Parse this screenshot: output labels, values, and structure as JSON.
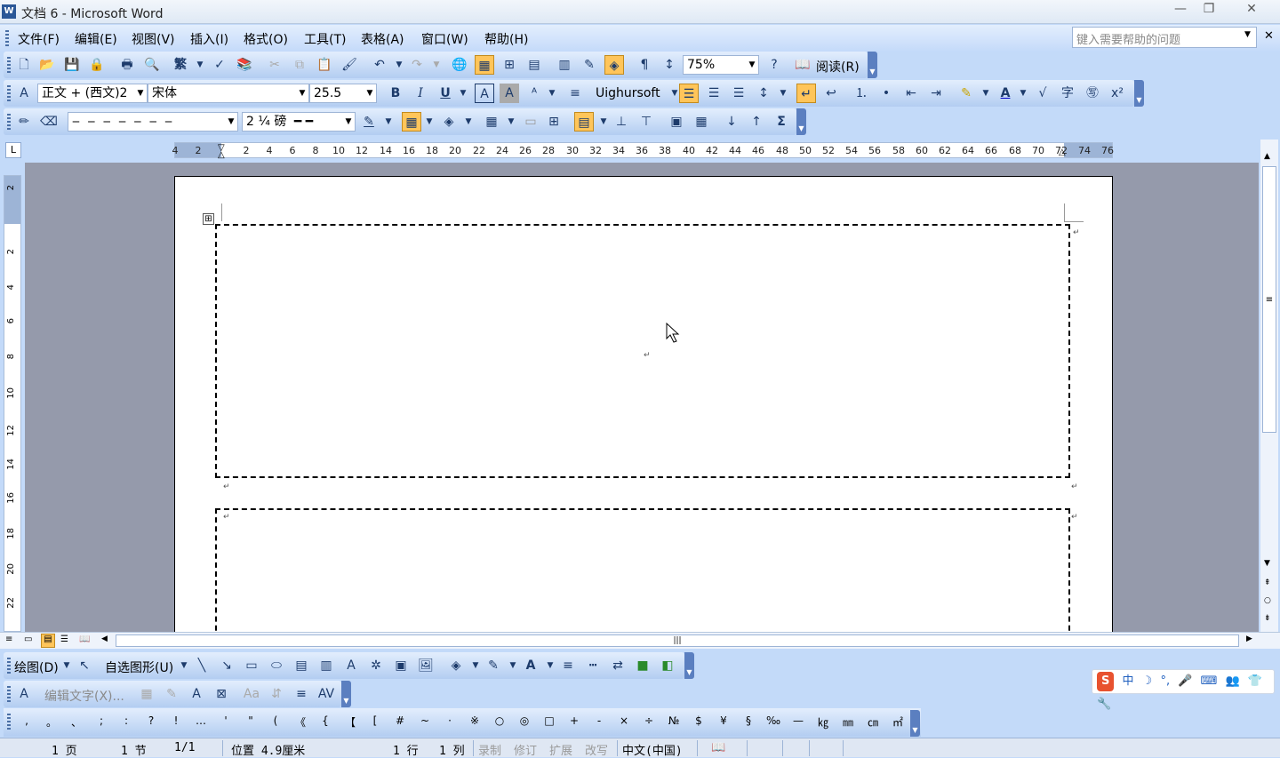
{
  "window": {
    "title": "文档 6 - Microsoft Word",
    "app_icon": "W",
    "controls": {
      "minimize": "—",
      "restore": "❐",
      "close": "✕"
    }
  },
  "menu": {
    "items": [
      "文件(F)",
      "编辑(E)",
      "视图(V)",
      "插入(I)",
      "格式(O)",
      "工具(T)",
      "表格(A)",
      "窗口(W)",
      "帮助(H)"
    ],
    "help_placeholder": "键入需要帮助的问题",
    "close_glyph": "✕"
  },
  "standard_toolbar": {
    "zoom": "75%",
    "read_label": "阅读(R)",
    "traditional_label": "繁"
  },
  "format_toolbar": {
    "style": "正文 + (西文)2",
    "font": "宋体",
    "size": "25.5",
    "uighur": "Uighursoft"
  },
  "tables_toolbar": {
    "line_weight": "2 ¼ 磅"
  },
  "ruler": {
    "numbers": [
      "4",
      "2",
      "2",
      "4",
      "6",
      "8",
      "10",
      "12",
      "14",
      "16",
      "18",
      "20",
      "22",
      "24",
      "26",
      "28",
      "30",
      "32",
      "34",
      "36",
      "38",
      "40",
      "42",
      "44",
      "46",
      "48",
      "50",
      "52",
      "54",
      "56",
      "58",
      "60",
      "62",
      "64",
      "66",
      "68",
      "70",
      "72",
      "74",
      "76"
    ],
    "vertical_numbers": [
      "2",
      "2",
      "4",
      "6",
      "8",
      "10",
      "12",
      "14",
      "16",
      "18",
      "20",
      "22"
    ],
    "tab_glyph": "L"
  },
  "document": {
    "paragraph_mark": "↵",
    "move_handle": "⊞"
  },
  "drawing_toolbar": {
    "draw_label": "绘图(D)",
    "autoshape_label": "自选图形(U)"
  },
  "wordart_toolbar": {
    "edit_text_label": "编辑文字(X)..."
  },
  "symbols": [
    ",",
    "。",
    "、",
    ";",
    ":",
    "?",
    "!",
    "…",
    "'",
    "\"",
    "(",
    "《",
    "{",
    "【",
    "[",
    "#",
    "~",
    "·",
    "※",
    "○",
    "◎",
    "□",
    "+",
    "-",
    "×",
    "÷",
    "№",
    "$",
    "¥",
    "§",
    "‰",
    "—",
    "㎏",
    "㎜",
    "㎝",
    "㎡"
  ],
  "ime": {
    "logo": "S",
    "items": [
      "中",
      "☽",
      "°,",
      "🎤",
      "⌨",
      "👥",
      "👕",
      "🔧"
    ]
  },
  "status_bar": {
    "page": "1 页",
    "section": "1 节",
    "pages": "1/1",
    "position": "位置 4.9厘米",
    "line": "1 行",
    "column": "1 列",
    "rec": "录制",
    "trk": "修订",
    "ext": "扩展",
    "ovr": "改写",
    "language": "中文(中国)"
  }
}
